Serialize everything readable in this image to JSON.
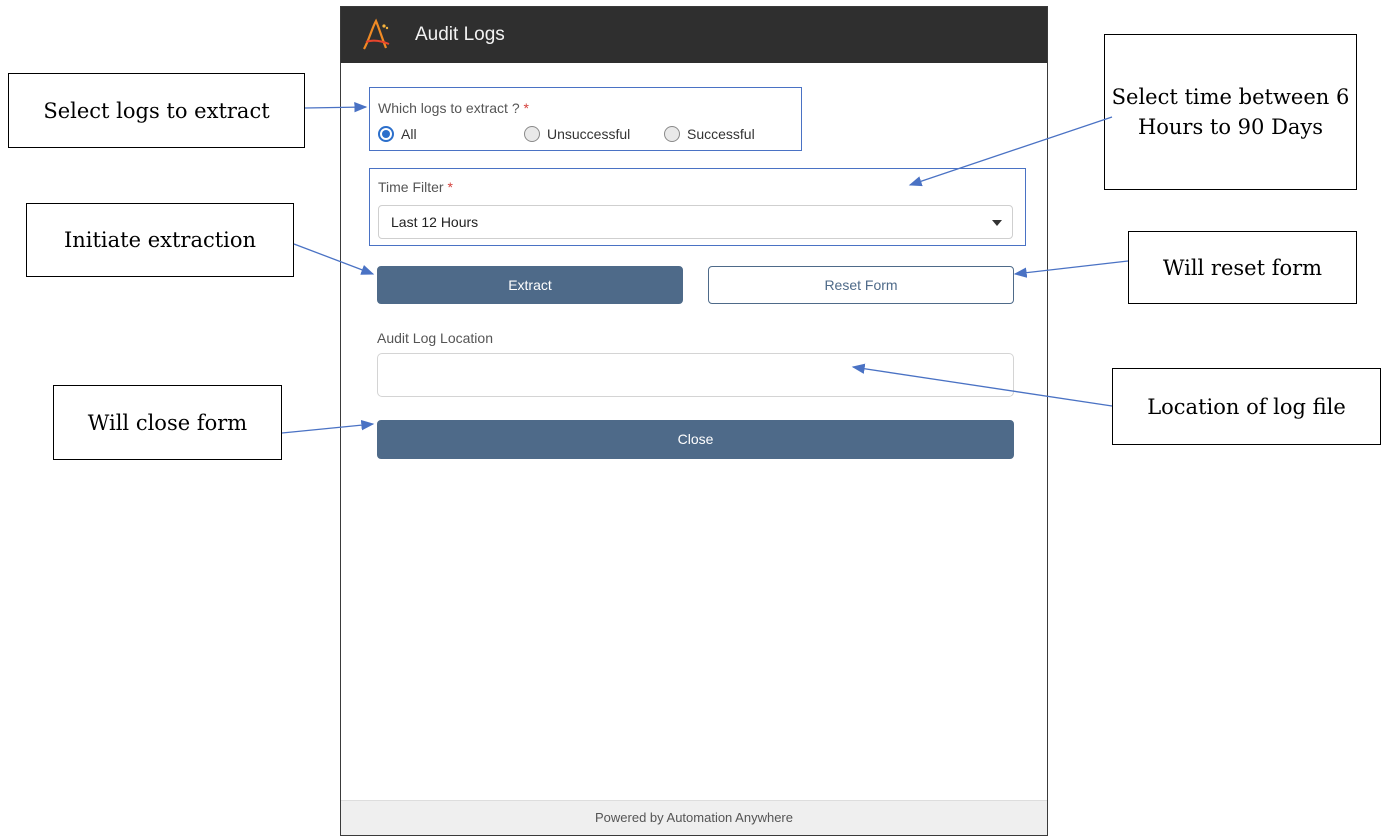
{
  "window": {
    "title": "Audit Logs",
    "footer": "Powered by Automation Anywhere"
  },
  "form": {
    "logs_label": "Which logs to extract ?",
    "required_mark": "*",
    "options": [
      {
        "label": "All",
        "selected": true
      },
      {
        "label": "Unsuccessful",
        "selected": false
      },
      {
        "label": "Successful",
        "selected": false
      }
    ],
    "time_filter_label": "Time Filter",
    "time_filter_value": "Last 12 Hours",
    "extract_label": "Extract",
    "reset_label": "Reset Form",
    "location_label": "Audit Log Location",
    "location_value": "",
    "close_label": "Close"
  },
  "callouts": {
    "select_logs": "Select logs to extract",
    "select_time": "Select time between 6 Hours to 90 Days",
    "initiate": "Initiate extraction",
    "reset": "Will reset form",
    "location": "Location of log file",
    "close": "Will close form"
  },
  "colors": {
    "titlebar": "#2f2f2f",
    "primary_button": "#4e6a89",
    "highlight_frame": "#4a72c4",
    "radio_selected": "#2c6fcb",
    "required": "#d43f3a"
  },
  "icons": {
    "logo": "automation-anywhere-logo",
    "dropdown": "caret-down"
  }
}
